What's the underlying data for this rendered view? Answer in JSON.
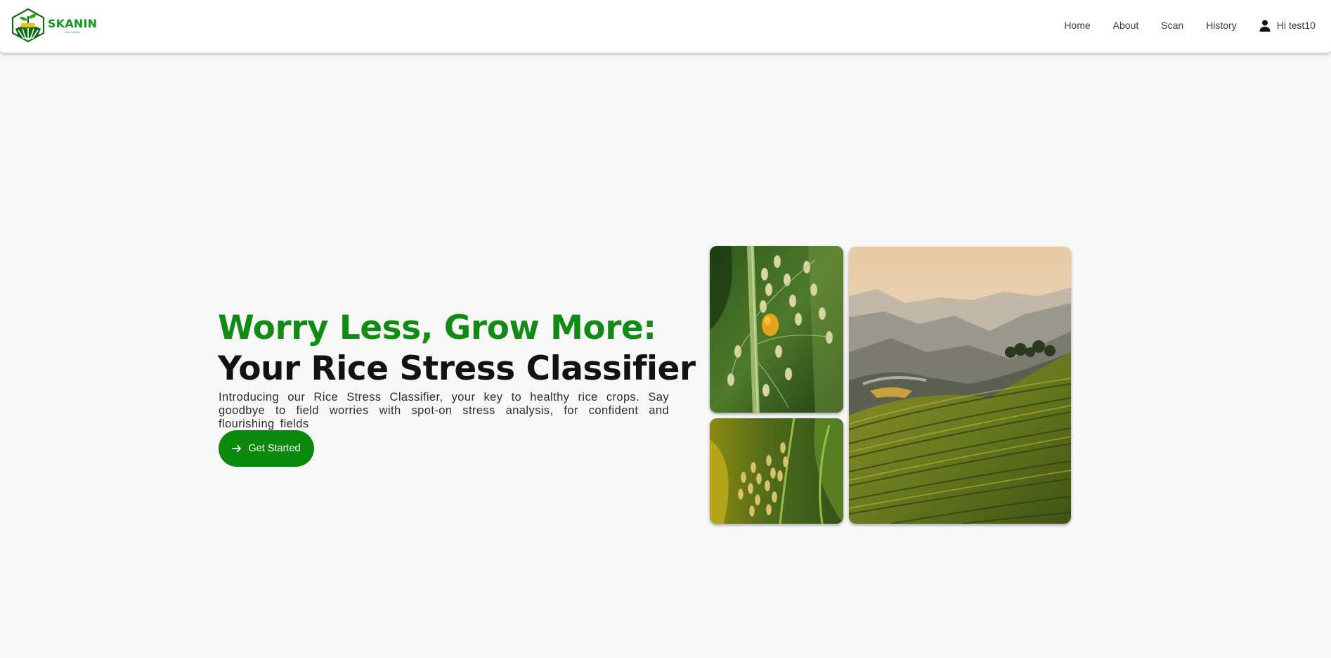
{
  "brand": {
    "name": "SKANIN",
    "tagline": "rice stress"
  },
  "nav": {
    "items": [
      {
        "label": "Home"
      },
      {
        "label": "About"
      },
      {
        "label": "Scan"
      },
      {
        "label": "History"
      }
    ],
    "user_label": "Hi test10",
    "user_icon": "person-icon"
  },
  "hero": {
    "title_line1": "Worry Less, Grow More:",
    "title_line2": "Your Rice Stress Classifier",
    "description": "Introducing our Rice Stress Classifier, your key to healthy rice crops. Say goodbye to field worries with spot-on stress analysis, for confident and flourishing fields",
    "cta_label": "Get Started",
    "cta_icon": "arrow-right-icon"
  },
  "gallery": {
    "images": [
      {
        "name": "rice-stalk-with-pest-image"
      },
      {
        "name": "rice-grain-heads-image"
      },
      {
        "name": "rice-terraces-landscape-image"
      }
    ]
  },
  "colors": {
    "brand_green": "#0f9a1b",
    "title_green": "#128b15",
    "button_green": "#0a8a0d",
    "background": "#f8f8f8"
  }
}
